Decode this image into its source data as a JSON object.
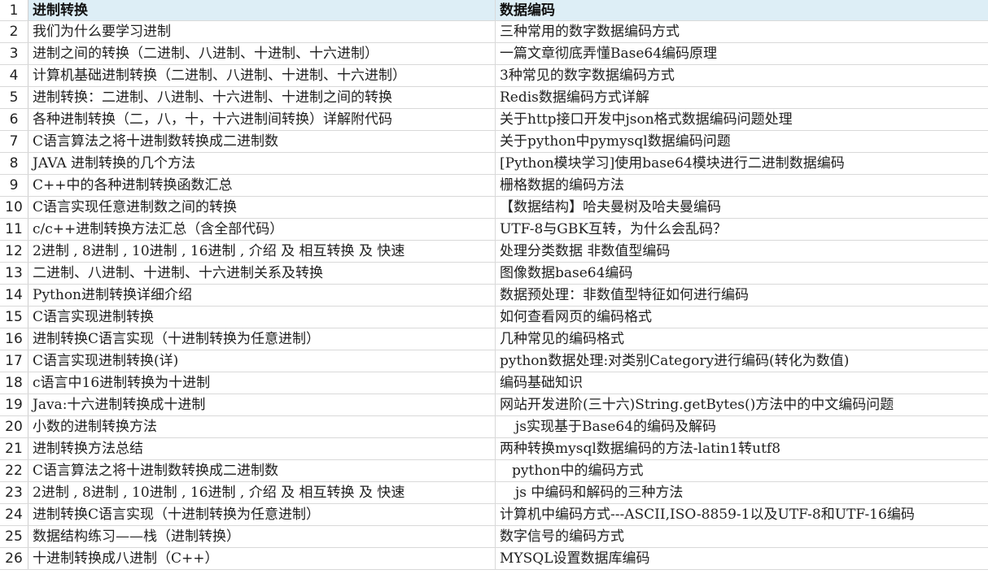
{
  "sheet": {
    "header": {
      "row_number": "1",
      "col_a": "进制转换",
      "col_b": "数据编码"
    },
    "rows": [
      {
        "n": "2",
        "a": "我们为什么要学习进制",
        "b": "三种常用的数字数据编码方式"
      },
      {
        "n": "3",
        "a": "进制之间的转换（二进制、八进制、十进制、十六进制）",
        "b": "一篇文章彻底弄懂Base64编码原理"
      },
      {
        "n": "4",
        "a": "计算机基础进制转换（二进制、八进制、十进制、十六进制）",
        "b": "3种常见的数字数据编码方式"
      },
      {
        "n": "5",
        "a": "进制转换：二进制、八进制、十六进制、十进制之间的转换",
        "b": "Redis数据编码方式详解"
      },
      {
        "n": "6",
        "a": "各种进制转换（二，八，十，十六进制间转换）详解附代码",
        "b": "关于http接口开发中json格式数据编码问题处理"
      },
      {
        "n": "7",
        "a": "C语言算法之将十进制数转换成二进制数",
        "b": "关于python中pymysql数据编码问题"
      },
      {
        "n": "8",
        "a": "JAVA 进制转换的几个方法",
        "b": "[Python模块学习]使用base64模块进行二进制数据编码"
      },
      {
        "n": "9",
        "a": "C++中的各种进制转换函数汇总",
        "b": "栅格数据的编码方法"
      },
      {
        "n": "10",
        "a": "C语言实现任意进制数之间的转换",
        "b": "【数据结构】哈夫曼树及哈夫曼编码"
      },
      {
        "n": "11",
        "a": "c/c++进制转换方法汇总（含全部代码）",
        "b": "UTF-8与GBK互转，为什么会乱码？"
      },
      {
        "n": "12",
        "a": "2进制 , 8进制 , 10进制 , 16进制 , 介绍 及 相互转换 及 快速",
        "b": "处理分类数据 非数值型编码"
      },
      {
        "n": "13",
        "a": "二进制、八进制、十进制、十六进制关系及转换",
        "b": "图像数据base64编码"
      },
      {
        "n": "14",
        "a": "Python进制转换详细介绍",
        "b": "数据预处理：非数值型特征如何进行编码"
      },
      {
        "n": "15",
        "a": "C语言实现进制转换",
        "b": "如何查看网页的编码格式"
      },
      {
        "n": "16",
        "a": "进制转换C语言实现（十进制转换为任意进制）",
        "b": "几种常见的编码格式"
      },
      {
        "n": "17",
        "a": "C语言实现进制转换(详)",
        "b": "python数据处理:对类别Category进行编码(转化为数值)"
      },
      {
        "n": "18",
        "a": "c语言中16进制转换为十进制",
        "b": "编码基础知识"
      },
      {
        "n": "19",
        "a": "Java:十六进制转换成十进制",
        "b": "网站开发进阶(三十六)String.getBytes()方法中的中文编码问题"
      },
      {
        "n": "20",
        "a": "小数的进制转换方法",
        "b": "js实现基于Base64的编码及解码",
        "indent": "indent"
      },
      {
        "n": "21",
        "a": "进制转换方法总结",
        "b": "两种转换mysql数据编码的方法-latin1转utf8"
      },
      {
        "n": "22",
        "a": "C语言算法之将十进制数转换成二进制数",
        "b": "python中的编码方式",
        "indent": "indent-sm"
      },
      {
        "n": "23",
        "a": "2进制 , 8进制 , 10进制 , 16进制 , 介绍 及 相互转换 及 快速",
        "b": "js 中编码和解码的三种方法",
        "indent": "indent"
      },
      {
        "n": "24",
        "a": "进制转换C语言实现（十进制转换为任意进制）",
        "b": "计算机中编码方式---ASCII,ISO-8859-1以及UTF-8和UTF-16编码"
      },
      {
        "n": "25",
        "a": "数据结构练习——栈（进制转换）",
        "b": "数字信号的编码方式"
      },
      {
        "n": "26",
        "a": "十进制转换成八进制（C++）",
        "b": "MYSQL设置数据库编码"
      }
    ]
  }
}
